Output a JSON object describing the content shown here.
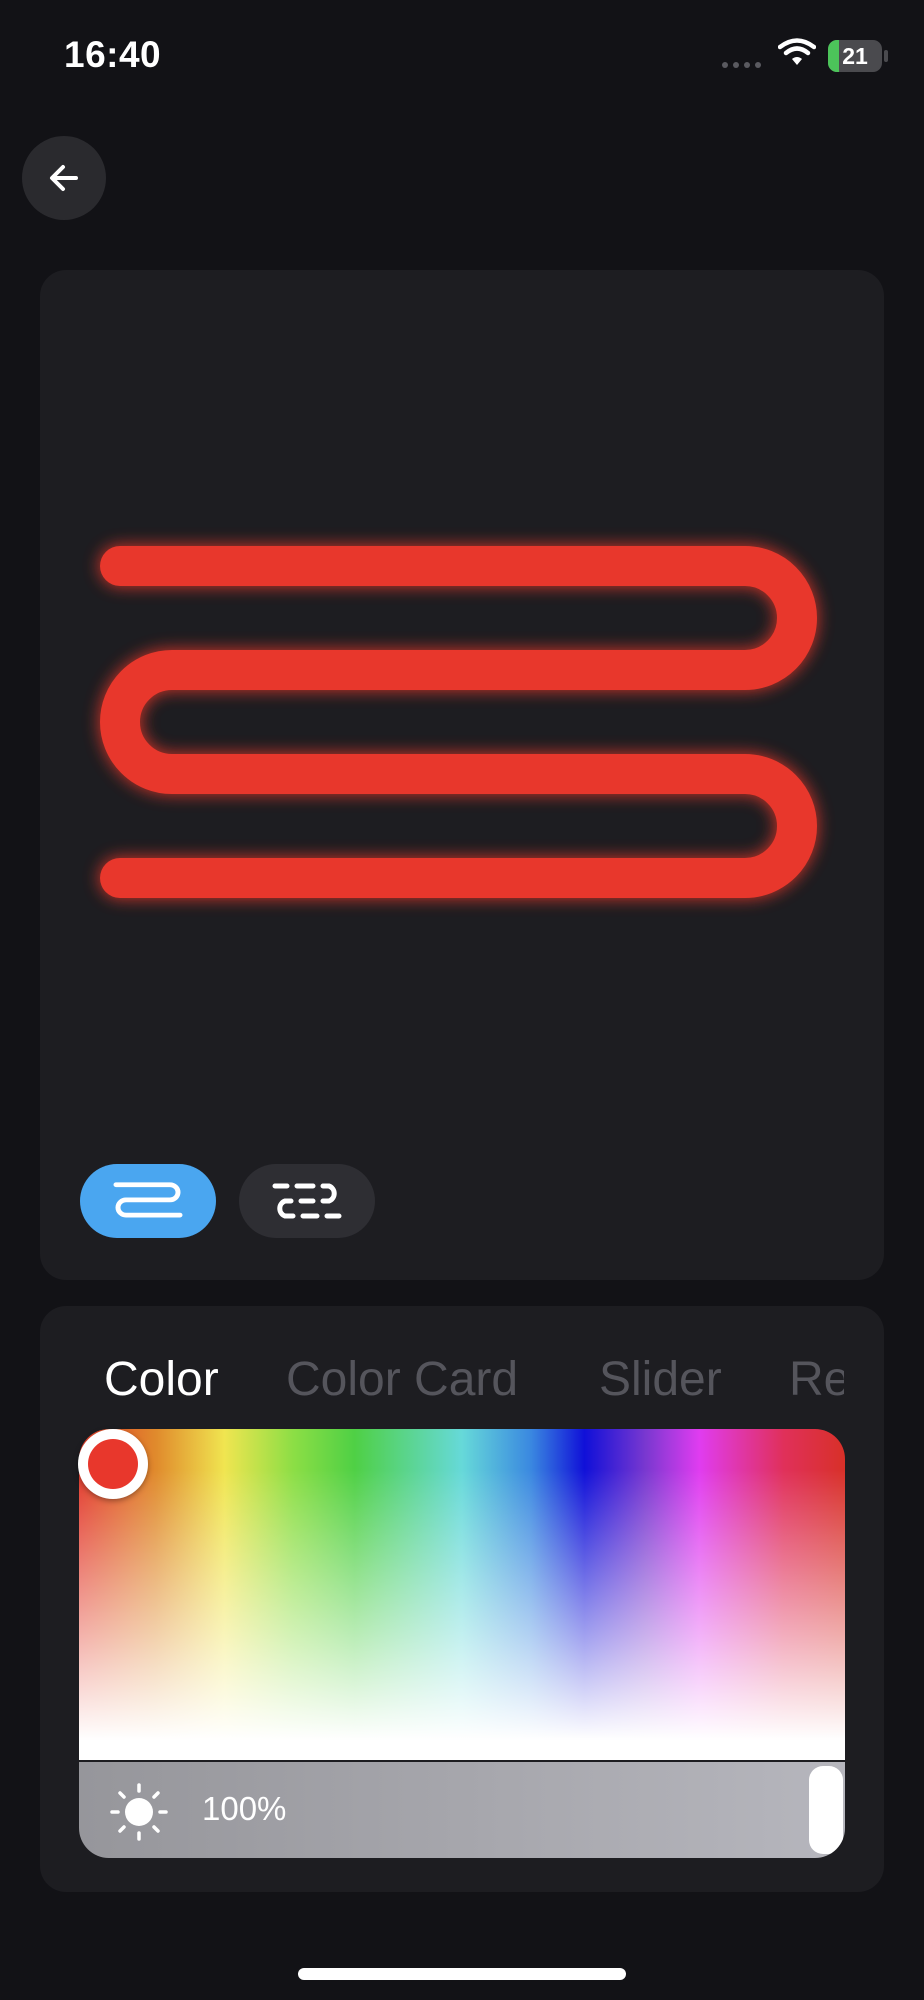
{
  "status_bar": {
    "time": "16:40",
    "battery_level": "21",
    "battery_color": "#4cc45a"
  },
  "preview": {
    "led_color": "#e8372c",
    "modes": [
      {
        "icon": "continuous-strip-icon",
        "active": true
      },
      {
        "icon": "segmented-strip-icon",
        "active": false
      }
    ]
  },
  "controls": {
    "tabs": [
      "Color",
      "Color Card",
      "Slider",
      "Re"
    ],
    "active_tab": "Color",
    "selected_color": "#e8372c",
    "brightness": "100%",
    "accent_color": "#4aa6f0"
  }
}
